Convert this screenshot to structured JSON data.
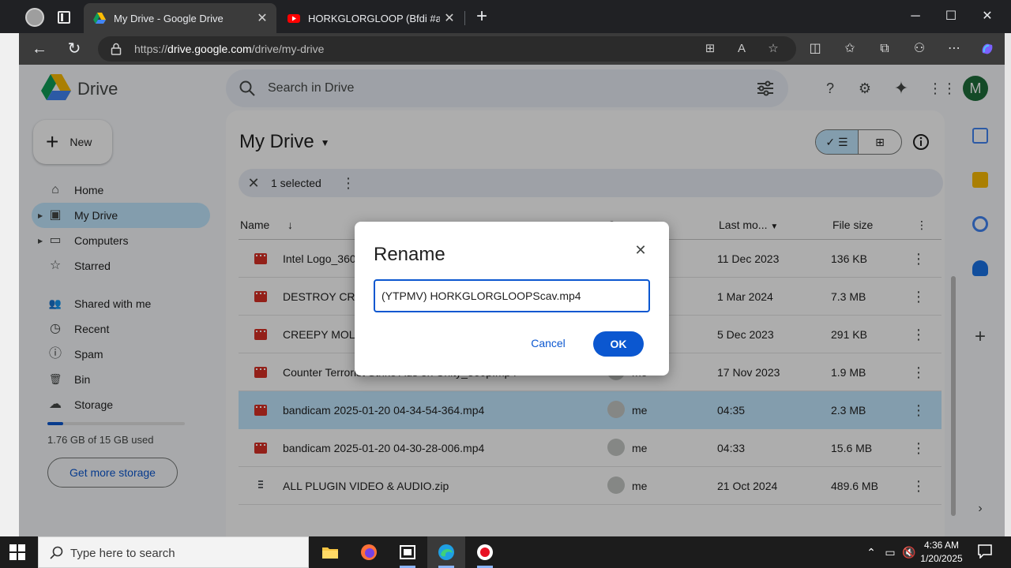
{
  "browser": {
    "tabs": [
      {
        "title": "My Drive - Google Drive",
        "active": true
      },
      {
        "title": "HORKGLORGLOOP (Bfdi #animatic",
        "active": false
      }
    ],
    "url_prefix": "https://",
    "url_domain": "drive.google.com",
    "url_path": "/drive/my-drive",
    "window_controls": {
      "minimize": "─",
      "maximize": "☐",
      "close": "✕"
    },
    "new_tab": "+",
    "tab_close": "✕"
  },
  "drive": {
    "logo_text": "Drive",
    "search_placeholder": "Search in Drive",
    "avatar_letter": "M",
    "new_label": "New",
    "nav": [
      {
        "label": "Home",
        "icon": "home-icon",
        "glyph": "⌂"
      },
      {
        "label": "My Drive",
        "icon": "my-drive-icon",
        "glyph": "▣",
        "selected": true,
        "expandable": true
      },
      {
        "label": "Computers",
        "icon": "computer-icon",
        "glyph": "▭",
        "expandable": true
      },
      {
        "label": "Starred",
        "icon": "star-icon",
        "glyph": "☆"
      },
      {
        "label": "Shared with me",
        "icon": "shared-icon",
        "glyph": "👥"
      },
      {
        "label": "Recent",
        "icon": "clock-icon",
        "glyph": "◷"
      },
      {
        "label": "Spam",
        "icon": "spam-icon",
        "glyph": "ⓘ"
      },
      {
        "label": "Bin",
        "icon": "bin-icon",
        "glyph": "🗑"
      },
      {
        "label": "Storage",
        "icon": "cloud-icon",
        "glyph": "☁"
      }
    ],
    "storage": {
      "text": "1.76 GB of 15 GB used",
      "fraction": 0.117,
      "button": "Get more storage"
    },
    "title": "My Drive",
    "selection": {
      "count_text": "1 selected"
    },
    "columns": {
      "name": "Name",
      "owner": "Owner",
      "modified": "Last mo...",
      "size": "File size"
    },
    "files": [
      {
        "name": "Intel Logo_360p.mp4",
        "owner": "me",
        "modified": "11 Dec 2023",
        "size": "136 KB",
        "type": "video"
      },
      {
        "name": "DESTROY CRAFT.mp4",
        "owner": "me",
        "modified": "1 Mar 2024",
        "size": "7.3 MB",
        "type": "video"
      },
      {
        "name": "CREEPY MOLE.mp4",
        "owner": "me",
        "modified": "5 Dec 2023",
        "size": "291 KB",
        "type": "video"
      },
      {
        "name": "Counter Terrorist Strike Ads on Unity_360p.mp4",
        "owner": "me",
        "modified": "17 Nov 2023",
        "size": "1.9 MB",
        "type": "video"
      },
      {
        "name": "bandicam 2025-01-20 04-34-54-364.mp4",
        "owner": "me",
        "modified": "04:35",
        "size": "2.3 MB",
        "type": "video",
        "selected": true
      },
      {
        "name": "bandicam 2025-01-20 04-30-28-006.mp4",
        "owner": "me",
        "modified": "04:33",
        "size": "15.6 MB",
        "type": "video"
      },
      {
        "name": "ALL PLUGIN VIDEO & AUDIO.zip",
        "owner": "me",
        "modified": "21 Oct 2024",
        "size": "489.6 MB",
        "type": "zip"
      }
    ]
  },
  "dialog": {
    "title": "Rename",
    "value": "(YTPMV) HORKGLORGLOOPScav.mp4",
    "cancel": "Cancel",
    "ok": "OK",
    "close": "✕"
  },
  "taskbar": {
    "search_placeholder": "Type here to search",
    "time": "4:36 AM",
    "date": "1/20/2025"
  },
  "colors": {
    "accent": "#0b57d0",
    "selected_bg": "#c2e7ff",
    "video_red": "#d93025"
  }
}
